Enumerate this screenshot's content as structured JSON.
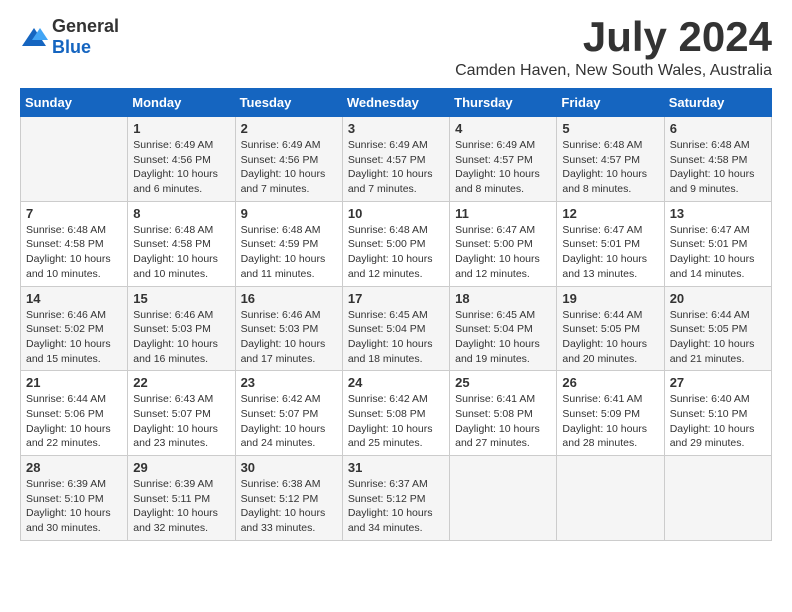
{
  "logo": {
    "text_general": "General",
    "text_blue": "Blue"
  },
  "header": {
    "month": "July 2024",
    "location": "Camden Haven, New South Wales, Australia"
  },
  "weekdays": [
    "Sunday",
    "Monday",
    "Tuesday",
    "Wednesday",
    "Thursday",
    "Friday",
    "Saturday"
  ],
  "weeks": [
    [
      {
        "day": "",
        "info": ""
      },
      {
        "day": "1",
        "info": "Sunrise: 6:49 AM\nSunset: 4:56 PM\nDaylight: 10 hours\nand 6 minutes."
      },
      {
        "day": "2",
        "info": "Sunrise: 6:49 AM\nSunset: 4:56 PM\nDaylight: 10 hours\nand 7 minutes."
      },
      {
        "day": "3",
        "info": "Sunrise: 6:49 AM\nSunset: 4:57 PM\nDaylight: 10 hours\nand 7 minutes."
      },
      {
        "day": "4",
        "info": "Sunrise: 6:49 AM\nSunset: 4:57 PM\nDaylight: 10 hours\nand 8 minutes."
      },
      {
        "day": "5",
        "info": "Sunrise: 6:48 AM\nSunset: 4:57 PM\nDaylight: 10 hours\nand 8 minutes."
      },
      {
        "day": "6",
        "info": "Sunrise: 6:48 AM\nSunset: 4:58 PM\nDaylight: 10 hours\nand 9 minutes."
      }
    ],
    [
      {
        "day": "7",
        "info": "Sunrise: 6:48 AM\nSunset: 4:58 PM\nDaylight: 10 hours\nand 10 minutes."
      },
      {
        "day": "8",
        "info": "Sunrise: 6:48 AM\nSunset: 4:58 PM\nDaylight: 10 hours\nand 10 minutes."
      },
      {
        "day": "9",
        "info": "Sunrise: 6:48 AM\nSunset: 4:59 PM\nDaylight: 10 hours\nand 11 minutes."
      },
      {
        "day": "10",
        "info": "Sunrise: 6:48 AM\nSunset: 5:00 PM\nDaylight: 10 hours\nand 12 minutes."
      },
      {
        "day": "11",
        "info": "Sunrise: 6:47 AM\nSunset: 5:00 PM\nDaylight: 10 hours\nand 12 minutes."
      },
      {
        "day": "12",
        "info": "Sunrise: 6:47 AM\nSunset: 5:01 PM\nDaylight: 10 hours\nand 13 minutes."
      },
      {
        "day": "13",
        "info": "Sunrise: 6:47 AM\nSunset: 5:01 PM\nDaylight: 10 hours\nand 14 minutes."
      }
    ],
    [
      {
        "day": "14",
        "info": "Sunrise: 6:46 AM\nSunset: 5:02 PM\nDaylight: 10 hours\nand 15 minutes."
      },
      {
        "day": "15",
        "info": "Sunrise: 6:46 AM\nSunset: 5:03 PM\nDaylight: 10 hours\nand 16 minutes."
      },
      {
        "day": "16",
        "info": "Sunrise: 6:46 AM\nSunset: 5:03 PM\nDaylight: 10 hours\nand 17 minutes."
      },
      {
        "day": "17",
        "info": "Sunrise: 6:45 AM\nSunset: 5:04 PM\nDaylight: 10 hours\nand 18 minutes."
      },
      {
        "day": "18",
        "info": "Sunrise: 6:45 AM\nSunset: 5:04 PM\nDaylight: 10 hours\nand 19 minutes."
      },
      {
        "day": "19",
        "info": "Sunrise: 6:44 AM\nSunset: 5:05 PM\nDaylight: 10 hours\nand 20 minutes."
      },
      {
        "day": "20",
        "info": "Sunrise: 6:44 AM\nSunset: 5:05 PM\nDaylight: 10 hours\nand 21 minutes."
      }
    ],
    [
      {
        "day": "21",
        "info": "Sunrise: 6:44 AM\nSunset: 5:06 PM\nDaylight: 10 hours\nand 22 minutes."
      },
      {
        "day": "22",
        "info": "Sunrise: 6:43 AM\nSunset: 5:07 PM\nDaylight: 10 hours\nand 23 minutes."
      },
      {
        "day": "23",
        "info": "Sunrise: 6:42 AM\nSunset: 5:07 PM\nDaylight: 10 hours\nand 24 minutes."
      },
      {
        "day": "24",
        "info": "Sunrise: 6:42 AM\nSunset: 5:08 PM\nDaylight: 10 hours\nand 25 minutes."
      },
      {
        "day": "25",
        "info": "Sunrise: 6:41 AM\nSunset: 5:08 PM\nDaylight: 10 hours\nand 27 minutes."
      },
      {
        "day": "26",
        "info": "Sunrise: 6:41 AM\nSunset: 5:09 PM\nDaylight: 10 hours\nand 28 minutes."
      },
      {
        "day": "27",
        "info": "Sunrise: 6:40 AM\nSunset: 5:10 PM\nDaylight: 10 hours\nand 29 minutes."
      }
    ],
    [
      {
        "day": "28",
        "info": "Sunrise: 6:39 AM\nSunset: 5:10 PM\nDaylight: 10 hours\nand 30 minutes."
      },
      {
        "day": "29",
        "info": "Sunrise: 6:39 AM\nSunset: 5:11 PM\nDaylight: 10 hours\nand 32 minutes."
      },
      {
        "day": "30",
        "info": "Sunrise: 6:38 AM\nSunset: 5:12 PM\nDaylight: 10 hours\nand 33 minutes."
      },
      {
        "day": "31",
        "info": "Sunrise: 6:37 AM\nSunset: 5:12 PM\nDaylight: 10 hours\nand 34 minutes."
      },
      {
        "day": "",
        "info": ""
      },
      {
        "day": "",
        "info": ""
      },
      {
        "day": "",
        "info": ""
      }
    ]
  ]
}
